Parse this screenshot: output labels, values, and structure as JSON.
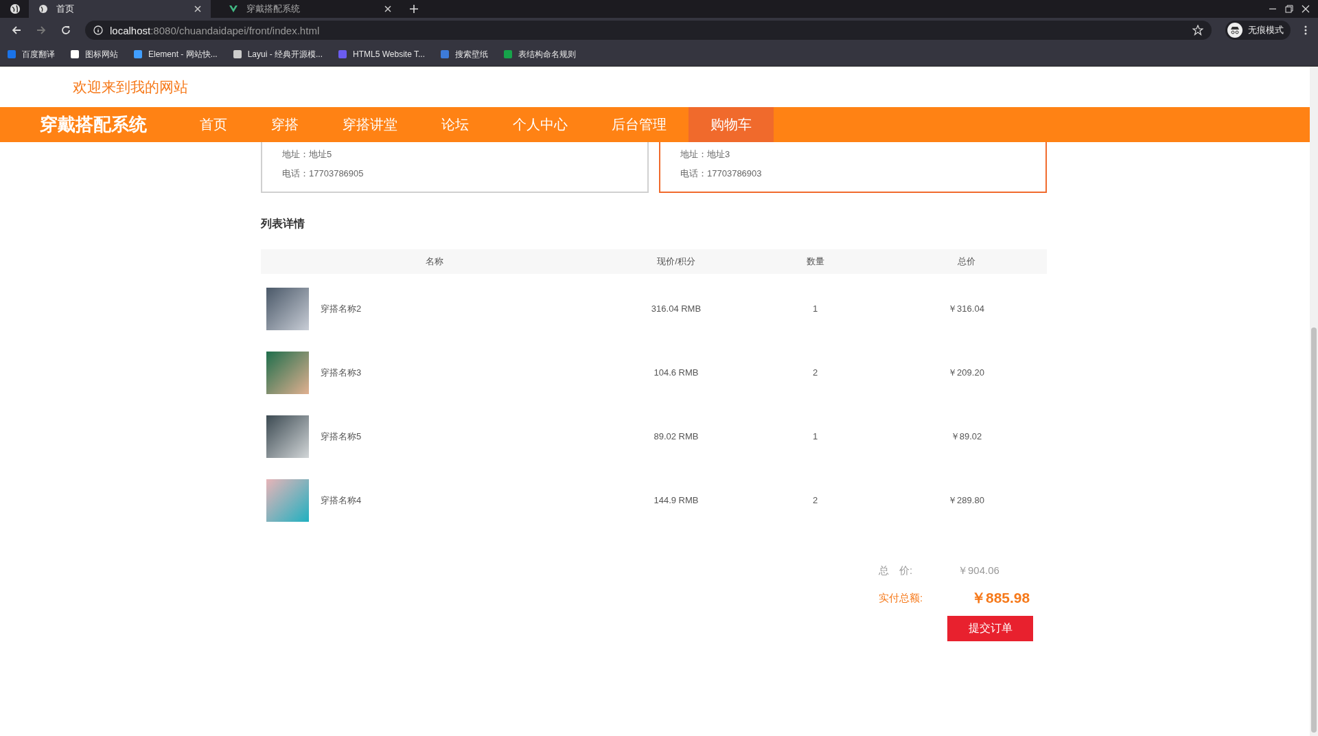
{
  "browser": {
    "tabs": [
      {
        "title": "首页",
        "selected": true
      },
      {
        "title": "穿戴搭配系统",
        "selected": false
      }
    ],
    "url_host": "localhost",
    "url_path": ":8080/chuandaidapei/front/index.html",
    "profile": "无痕模式",
    "bookmarks": [
      "百度翻译",
      "图标网站",
      "Element - 网站快...",
      "Layui - 经典开源模...",
      "HTML5 Website T...",
      "搜索壁纸",
      "表结构命名规则"
    ]
  },
  "header": {
    "welcome": "欢迎来到我的网站"
  },
  "nav": {
    "brand": "穿戴搭配系统",
    "items": [
      {
        "label": "首页",
        "selected": false
      },
      {
        "label": "穿搭",
        "selected": false
      },
      {
        "label": "穿搭讲堂",
        "selected": false
      },
      {
        "label": "论坛",
        "selected": false
      },
      {
        "label": "个人中心",
        "selected": false
      },
      {
        "label": "后台管理",
        "selected": false
      },
      {
        "label": "购物车",
        "selected": true
      }
    ]
  },
  "addresses": [
    {
      "address": "地址：地址5",
      "phone": "电话：17703786905",
      "selected": false
    },
    {
      "address": "地址：地址3",
      "phone": "电话：17703786903",
      "selected": true
    }
  ],
  "section_title": "列表详情",
  "table": {
    "columns": [
      "名称",
      "现价/积分",
      "数量",
      "总价"
    ],
    "rows": [
      {
        "name": "穿搭名称2",
        "price": "316.04 RMB",
        "qty": "1",
        "total": "￥316.04"
      },
      {
        "name": "穿搭名称3",
        "price": "104.6 RMB",
        "qty": "2",
        "total": "￥209.20"
      },
      {
        "name": "穿搭名称5",
        "price": "89.02 RMB",
        "qty": "1",
        "total": "￥89.02"
      },
      {
        "name": "穿搭名称4",
        "price": "144.9 RMB",
        "qty": "2",
        "total": "￥289.80"
      }
    ]
  },
  "summary": {
    "total_label": "总　价:",
    "total": "￥904.06",
    "paid_label": "实付总额:",
    "paid": "￥885.98",
    "submit": "提交订单"
  }
}
